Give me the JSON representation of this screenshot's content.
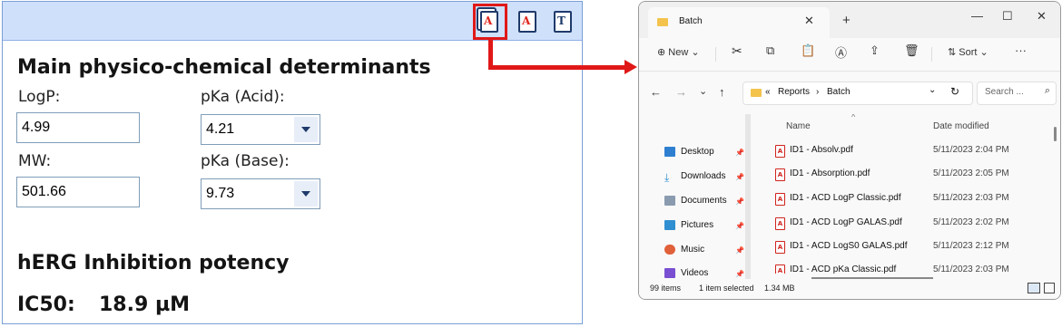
{
  "left_panel": {
    "toolbar": {
      "batch_glyph": "A",
      "pdf_glyph": "A",
      "txt_glyph": "T",
      "highlight_color": "#e01818"
    },
    "section1_title": "Main physico-chemical determinants",
    "fields": {
      "logp": {
        "label": "LogP:",
        "value": "4.99"
      },
      "pka_acid": {
        "label": "pKa (Acid):",
        "value": "4.21"
      },
      "mw": {
        "label": "MW:",
        "value": "501.66"
      },
      "pka_base": {
        "label": "pKa (Base):",
        "value": "9.73"
      }
    },
    "section2_title": "hERG Inhibition potency",
    "ic50": {
      "label": "IC50:",
      "value": "18.9 µM"
    }
  },
  "explorer": {
    "tab_title": "Batch",
    "tab_close": "✕",
    "new_tab": "+",
    "window_controls": {
      "minimize": "—",
      "maximize": "☐",
      "close": "✕"
    },
    "commands": {
      "new": "New",
      "sort": "Sort",
      "more": "···"
    },
    "address": {
      "prefix": "«",
      "crumbs": [
        "Reports",
        "Batch"
      ],
      "separator": "›"
    },
    "search_placeholder": "Search ...",
    "nav_items": [
      {
        "label": "Desktop",
        "icon": "desktop-icon",
        "color": "#2f7fd1"
      },
      {
        "label": "Downloads",
        "icon": "download-icon",
        "color": "#2f8fd1"
      },
      {
        "label": "Documents",
        "icon": "documents-icon",
        "color": "#8a9bb0"
      },
      {
        "label": "Pictures",
        "icon": "pictures-icon",
        "color": "#2f8fd1"
      },
      {
        "label": "Music",
        "icon": "music-icon",
        "color": "#e0603a"
      },
      {
        "label": "Videos",
        "icon": "videos-icon",
        "color": "#7a4fd1"
      }
    ],
    "columns": {
      "name": "Name",
      "date": "Date modified"
    },
    "files": [
      {
        "name": "ID1 - Absolv.pdf",
        "date": "5/11/2023 2:04 PM"
      },
      {
        "name": "ID1 - Absorption.pdf",
        "date": "5/11/2023 2:05 PM"
      },
      {
        "name": "ID1 - ACD LogP Classic.pdf",
        "date": "5/11/2023 2:03 PM"
      },
      {
        "name": "ID1 - ACD LogP GALAS.pdf",
        "date": "5/11/2023 2:02 PM"
      },
      {
        "name": "ID1 - ACD LogS0 GALAS.pdf",
        "date": "5/11/2023 2:12 PM"
      },
      {
        "name": "ID1 - ACD pKa Classic.pdf",
        "date": "5/11/2023 2:03 PM"
      }
    ],
    "status": {
      "items": "99 items",
      "selected": "1 item selected",
      "size": "1.34 MB"
    }
  }
}
